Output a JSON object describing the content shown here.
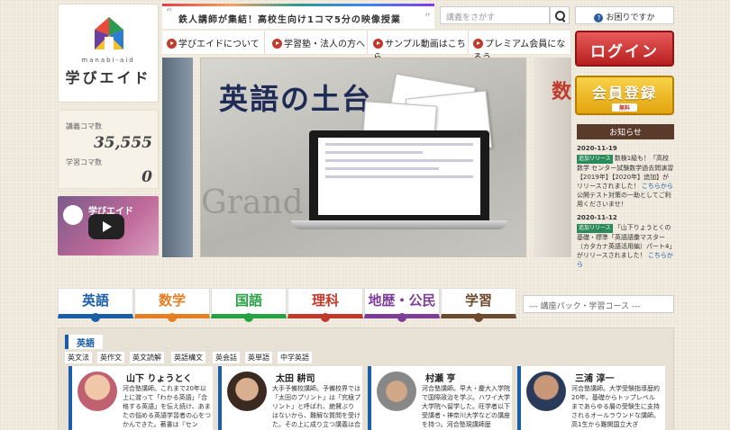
{
  "logo": {
    "sub": "manabi-aid",
    "name": "学びエイド"
  },
  "counter": {
    "lecture_label": "講義コマ数",
    "lecture_value": "35,555",
    "study_label": "学習コマ数",
    "study_value": "0"
  },
  "video": {
    "title": "学びエイド"
  },
  "banner": {
    "text": "鉄人講師が集結！高校生向け1コマ5分の映像授業"
  },
  "search": {
    "placeholder": "講義をさがす"
  },
  "help": {
    "label": "お困りですか"
  },
  "nav": [
    {
      "label": "学びエイドについて"
    },
    {
      "label": "学習塾・法人の方へ"
    },
    {
      "label": "サンプル動画はこちら"
    },
    {
      "label": "プレミアム会員になろう"
    }
  ],
  "auth": {
    "login": "ログイン",
    "register": "会員登録",
    "register_sub": "無料"
  },
  "hero": {
    "title": "英語の土台",
    "bg_text": "Grand Floral",
    "right_text": "数"
  },
  "news": {
    "heading": "お知らせ",
    "items": [
      {
        "date": "2020-11-19",
        "tag": "追加リリース",
        "text": "数検1級も！「高校数学 センター試験数学過去問演習【2019年】【2020年】追加】がリリースされました！",
        "link": "こちらから",
        "tail": "公開テスト対策の一助としてご利用くださいませ！"
      },
      {
        "date": "2020-11-12",
        "tag": "追加リリース",
        "text": "「山下りょうとくの基礎・標準「英語語彙マスター（カタカナ英語活用編）パート4」がリリースされました！",
        "link": "こちらから",
        "tail": ""
      }
    ]
  },
  "subjects": [
    {
      "label": "英語",
      "color": "#1a5ea8"
    },
    {
      "label": "数学",
      "color": "#e67e22"
    },
    {
      "label": "国語",
      "color": "#27a243"
    },
    {
      "label": "理科",
      "color": "#c0392b"
    },
    {
      "label": "地歴・公民",
      "color": "#7d3c98"
    },
    {
      "label": "学習",
      "color": "#6e4a2e"
    }
  ],
  "course_select": {
    "value": "--- 講座パック・学習コース ---"
  },
  "english": {
    "label": "英語",
    "chips": [
      "英文法",
      "英作文",
      "英文読解",
      "英語構文",
      "英会話",
      "英単語",
      "中学英語"
    ],
    "teachers": [
      {
        "name": "山下 りょうとく",
        "desc": "河合塾講師。これまで20年以上に渡って「わかる英語」「合格する英語」を伝え続け、あまたの悩める英語学習者の心をつかんできた。著書は『セン"
      },
      {
        "name": "太田 耕司",
        "desc": "大手予備校講師。予備校界では「太田のプリント」は「究極プリント」と呼ばれ、絶賛ぶりはないから、難解な質問を受けた。その上に成り立つ講義は合理"
      },
      {
        "name": "村瀬 亨",
        "desc": "河合塾講師。早大・慶大入学院で国際政治を学ぶ。ハワイ大学大学院へ留学した。旺学者以下受講者・神奈川大学などの講座を持つ。河合塾現講師歴"
      },
      {
        "name": "三浦 淳一",
        "desc": "河合塾講師。大学受験指導歴約20年。基礎からトップレベルまであらゆる層の受験生に支持されるオールラウンドな講師。高1生から難関国立大ぎ"
      }
    ]
  }
}
